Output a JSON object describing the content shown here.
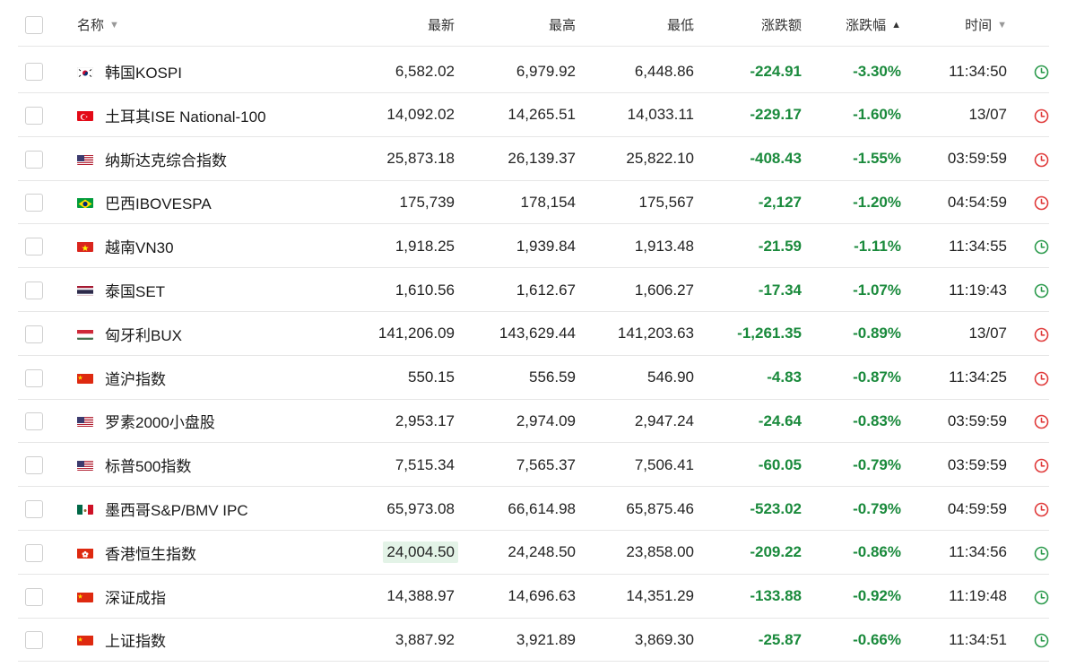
{
  "header": {
    "name": "名称",
    "last": "最新",
    "high": "最高",
    "low": "最低",
    "change": "涨跌额",
    "change_pct": "涨跌幅",
    "time": "时间"
  },
  "colors": {
    "up": "#1a8a3c",
    "clock_green": "#2d9b4e",
    "clock_red": "#e03b3b",
    "highlight": "#e3f3e7"
  },
  "rows": [
    {
      "name": "韩国KOSPI",
      "flag": "kr-flag",
      "last": "6,582.02",
      "high": "6,979.92",
      "low": "6,448.86",
      "change": "-224.91",
      "pct": "-3.30%",
      "time": "11:34:50",
      "status": "open"
    },
    {
      "name": "土耳其ISE National-100",
      "flag": "tr-flag",
      "last": "14,092.02",
      "high": "14,265.51",
      "low": "14,033.11",
      "change": "-229.17",
      "pct": "-1.60%",
      "time": "13/07",
      "status": "closed"
    },
    {
      "name": "纳斯达克综合指数",
      "flag": "us-flag",
      "last": "25,873.18",
      "high": "26,139.37",
      "low": "25,822.10",
      "change": "-408.43",
      "pct": "-1.55%",
      "time": "03:59:59",
      "status": "closed"
    },
    {
      "name": "巴西IBOVESPA",
      "flag": "br-flag",
      "last": "175,739",
      "high": "178,154",
      "low": "175,567",
      "change": "-2,127",
      "pct": "-1.20%",
      "time": "04:54:59",
      "status": "closed"
    },
    {
      "name": "越南VN30",
      "flag": "vn-flag",
      "last": "1,918.25",
      "high": "1,939.84",
      "low": "1,913.48",
      "change": "-21.59",
      "pct": "-1.11%",
      "time": "11:34:55",
      "status": "open"
    },
    {
      "name": "泰国SET",
      "flag": "th-flag",
      "last": "1,610.56",
      "high": "1,612.67",
      "low": "1,606.27",
      "change": "-17.34",
      "pct": "-1.07%",
      "time": "11:19:43",
      "status": "open"
    },
    {
      "name": "匈牙利BUX",
      "flag": "hu-flag",
      "last": "141,206.09",
      "high": "143,629.44",
      "low": "141,203.63",
      "change": "-1,261.35",
      "pct": "-0.89%",
      "time": "13/07",
      "status": "closed"
    },
    {
      "name": "道沪指数",
      "flag": "cn-flag",
      "last": "550.15",
      "high": "556.59",
      "low": "546.90",
      "change": "-4.83",
      "pct": "-0.87%",
      "time": "11:34:25",
      "status": "closed"
    },
    {
      "name": "罗素2000小盘股",
      "flag": "us-flag",
      "last": "2,953.17",
      "high": "2,974.09",
      "low": "2,947.24",
      "change": "-24.64",
      "pct": "-0.83%",
      "time": "03:59:59",
      "status": "closed"
    },
    {
      "name": "标普500指数",
      "flag": "us-flag",
      "last": "7,515.34",
      "high": "7,565.37",
      "low": "7,506.41",
      "change": "-60.05",
      "pct": "-0.79%",
      "time": "03:59:59",
      "status": "closed"
    },
    {
      "name": "墨西哥S&P/BMV IPC",
      "flag": "mx-flag",
      "last": "65,973.08",
      "high": "66,614.98",
      "low": "65,875.46",
      "change": "-523.02",
      "pct": "-0.79%",
      "time": "04:59:59",
      "status": "closed"
    },
    {
      "name": "香港恒生指数",
      "flag": "hk-flag",
      "last": "24,004.50",
      "high": "24,248.50",
      "low": "23,858.00",
      "change": "-209.22",
      "pct": "-0.86%",
      "time": "11:34:56",
      "status": "open",
      "highlight_last": true
    },
    {
      "name": "深证成指",
      "flag": "cn-flag",
      "last": "14,388.97",
      "high": "14,696.63",
      "low": "14,351.29",
      "change": "-133.88",
      "pct": "-0.92%",
      "time": "11:19:48",
      "status": "open"
    },
    {
      "name": "上证指数",
      "flag": "cn-flag",
      "last": "3,887.92",
      "high": "3,921.89",
      "low": "3,869.30",
      "change": "-25.87",
      "pct": "-0.66%",
      "time": "11:34:51",
      "status": "open"
    }
  ]
}
